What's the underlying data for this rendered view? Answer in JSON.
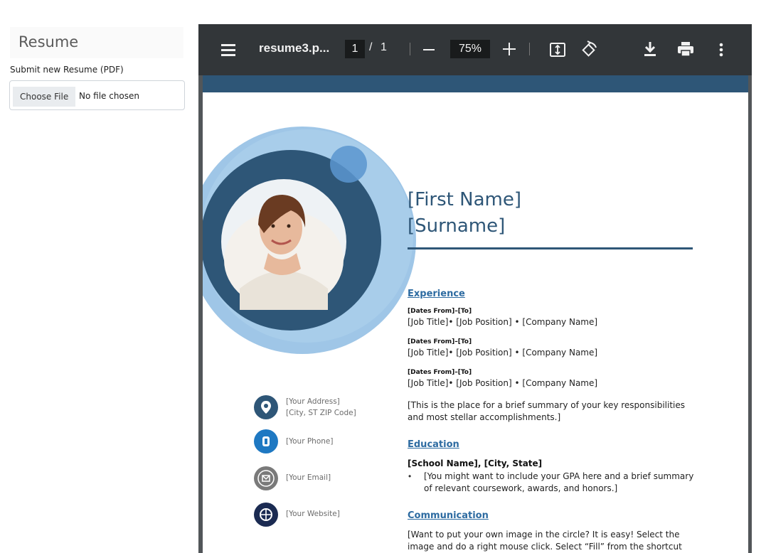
{
  "sidebar": {
    "title": "Resume",
    "upload_label": "Submit new Resume (PDF)",
    "choose_file_label": "Choose File",
    "file_status": "No file chosen"
  },
  "viewer": {
    "doc_title": "resume3.p...",
    "page_current": "1",
    "page_separator": "/",
    "page_total": "1",
    "zoom": "75%"
  },
  "resume": {
    "first_name": "[First Name]",
    "surname": "[Surname]",
    "experience_heading": "Experience",
    "jobs": [
      {
        "dates": "[Dates From]–[To]",
        "line": "[Job Title]• [Job Position] • [Company Name]"
      },
      {
        "dates": "[Dates From]–[To]",
        "line": "[Job Title]• [Job Position] • [Company Name]"
      },
      {
        "dates": "[Dates From]–[To]",
        "line": "[Job Title]• [Job Position] • [Company Name]"
      }
    ],
    "summary": "[This is the place for a brief summary of your key responsibilities and most stellar accomplishments.]",
    "education_heading": "Education",
    "school": "[School Name], [City, State]",
    "bullet_symbol": "•",
    "education_bullet": "[You might want to include your GPA here and a brief summary of relevant coursework, awards, and honors.]",
    "communication_heading": "Communication",
    "communication_text": "[Want to put your own image in the circle?  It is easy!  Select the image and do a right mouse click.  Select “Fill” from the shortcut menu.",
    "contact": {
      "address_line1": "[Your Address]",
      "address_line2": "[City, ST ZIP Code]",
      "phone": "[Your Phone]",
      "email": "[Your Email]",
      "website": "[Your Website]"
    }
  },
  "icons": {
    "menu": "hamburger-icon",
    "fit": "fit-to-page-icon",
    "rotate": "rotate-icon",
    "download": "download-icon",
    "print": "print-icon",
    "more": "more-vertical-icon",
    "address": "location-pin-icon",
    "phone": "phone-icon",
    "email": "envelope-icon",
    "website": "globe-icon"
  },
  "colors": {
    "toolbar": "#323639",
    "viewer_bg": "#525659",
    "resume_navy": "#2e5677",
    "resume_light_blue": "#9fc6e7",
    "heading_link": "#2d6ba1",
    "phone_icon": "#1e78c2"
  }
}
